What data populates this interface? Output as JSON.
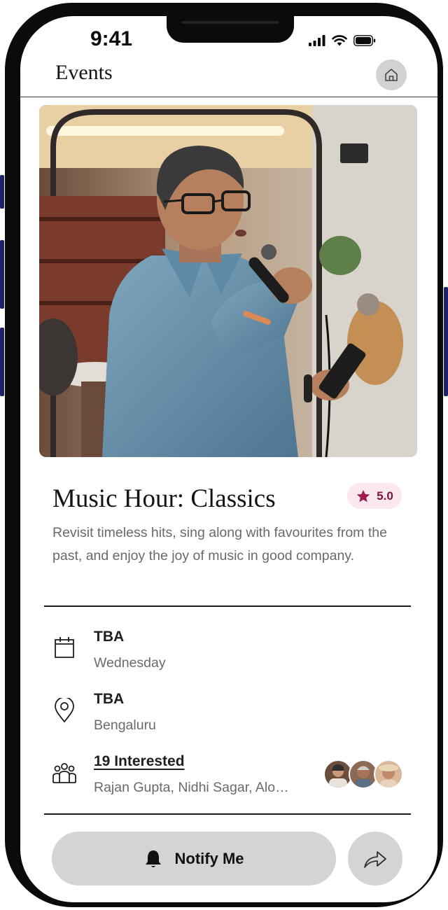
{
  "status_bar": {
    "time": "9:41",
    "icons": [
      "signal-icon",
      "wifi-icon",
      "battery-icon"
    ]
  },
  "header": {
    "title": "Events",
    "home_icon": "home-icon"
  },
  "event": {
    "title": "Music Hour: Classics",
    "rating": "5.0",
    "description": "Revisit timeless hits, sing along with favourites from the past, and enjoy the joy of music in good company.",
    "date": {
      "main": "TBA",
      "sub": "Wednesday",
      "icon": "calendar-icon"
    },
    "location": {
      "main": "TBA",
      "sub": "Bengaluru",
      "icon": "location-pin-icon"
    },
    "interested": {
      "main": "19 Interested",
      "sub": "Rajan Gupta, Nidhi Sagar, Alo…",
      "icon": "people-icon"
    }
  },
  "actions": {
    "notify_label": "Notify Me",
    "notify_icon": "bell-icon",
    "share_icon": "share-icon"
  },
  "colors": {
    "accent": "#a01c4e",
    "rating_bg": "#fbe8ef",
    "button_bg": "#d4d4d4",
    "frame": "#0b0b0b"
  }
}
